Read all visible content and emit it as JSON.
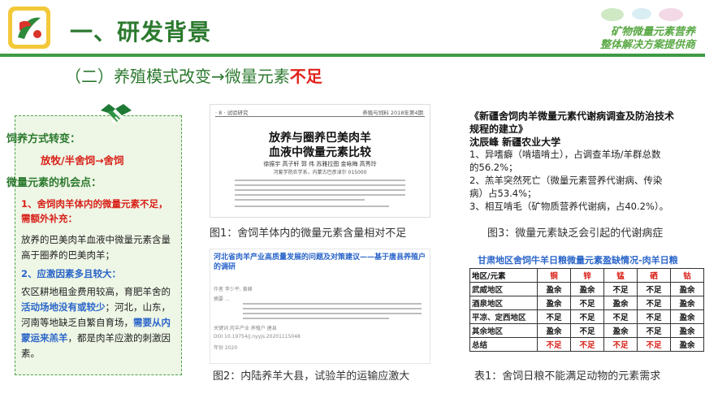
{
  "header": {
    "title": "一、研发背景",
    "brand_line1": "矿物微量元素营养",
    "brand_line2": "整体解决方案提供商"
  },
  "subtitle": {
    "main": "（二）养殖模式改变→微量元素",
    "highlight": "不足"
  },
  "left_panel": {
    "heading1": "饲养方式转变：",
    "change": "放牧/半舍饲→舍饲",
    "heading2": "微量元素的机会点：",
    "point1_a": "1、舍饲肉羊体内的微量元素不足，",
    "point1_b": "需额外补充：",
    "text1": "放养的巴美肉羊血液中微量元素含量高于圈养的巴美肉羊；",
    "point2": "2、应激因素多且较大：",
    "text2_a": "农区耕地租金费用较高，育肥羊舍的",
    "text2_b": "活动场地没有或较少",
    "text2_c": "；河北，山东，河南等地缺乏自繁自育场，",
    "text2_d": "需要从内蒙运来羔羊",
    "text2_e": "，都是肉羊应激的刺激因素。"
  },
  "figure1": {
    "journal_left": "· 8 ·    试验研究",
    "journal_right": "养殖与饲料 2018年第4期",
    "title_line1": "放养与圈养巴美肉羊",
    "title_line2": "血液中微量元素比较",
    "authors": "徐振宇   高子轩   郭  伟   苏雅拉图   金咏梅   高秀玲",
    "affiliation": "河套学院农学系，内蒙古巴彦淖尔 015000",
    "caption": "图1：舍饲羊体内的微量元素含量相对不足"
  },
  "figure2": {
    "title": "河北省肉羊产业高质量发展的问题及对策建议——基于唐县养殖户的调研",
    "rows": [
      "作者  李少平, 黄峰",
      "摘要  ...",
      "关键词  肉羊产业  养殖户  唐县",
      "DOI  10.19754/j.nyyjs.20201115048",
      "年份  2020"
    ],
    "caption": "图2：内陆养羊大县，试验羊的运输应激大"
  },
  "right_text": {
    "title_line1": "《新疆舍饲肉羊微量元素代谢病调查及防治技术",
    "title_line2": "规程的建立》",
    "author": "沈辰峰 新疆农业大学",
    "items": [
      "1、异嗜癖（啃墙啃土），占调查羊场/羊群总数",
      "的56.2%；",
      "2、羔羊突然死亡（微量元素营养代谢病、传染",
      "病）占53.4%；",
      "3、相互啃毛（矿物质营养代谢病，占40.2%）。"
    ],
    "caption": "图3：微量元素缺乏会引起的代谢病症"
  },
  "table": {
    "title": "甘肃地区舍饲牛羊日粮微量元素盈缺情况-肉羊日粮",
    "headers": [
      "地区/元素",
      "铜",
      "锌",
      "锰",
      "硒",
      "钴"
    ],
    "rows": [
      [
        "武威地区",
        "盈余",
        "盈余",
        "不足",
        "不足",
        "盈余"
      ],
      [
        "酒泉地区",
        "盈余",
        "不足",
        "盈余",
        "不足",
        "盈余"
      ],
      [
        "平凉、定西地区",
        "不足",
        "不足",
        "不足",
        "不足",
        "盈余"
      ],
      [
        "其余地区",
        "盈余",
        "不足",
        "盈余",
        "不足",
        "盈余"
      ],
      [
        "总结",
        "不足",
        "不足",
        "不足",
        "不足",
        "盈余"
      ]
    ],
    "caption": "表1：舍饲日粮不能满足动物的元素需求"
  },
  "colors": {
    "green": "#2c7a2f",
    "red": "#d81e16",
    "blue": "#2a65c9"
  }
}
